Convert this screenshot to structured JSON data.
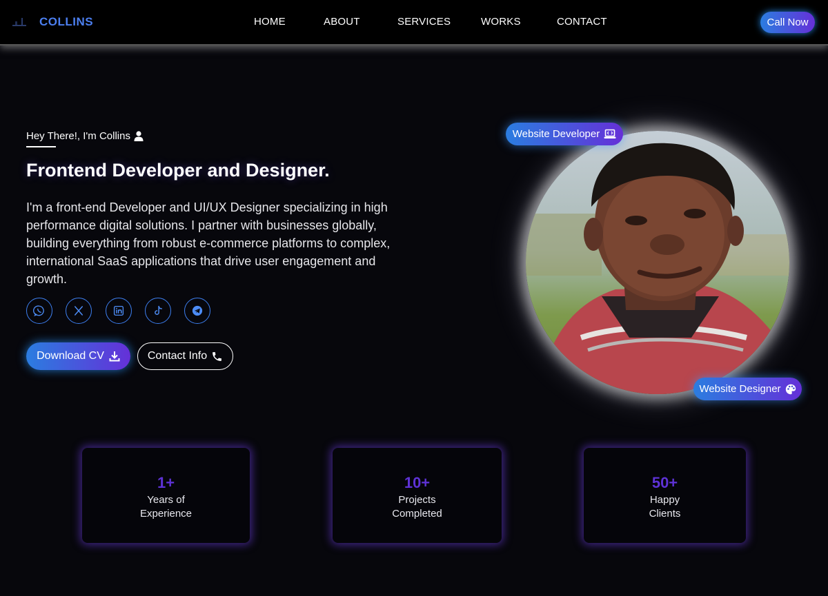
{
  "nav": {
    "brand": "COLLINS",
    "links": [
      {
        "label": "HOME"
      },
      {
        "label": "ABOUT"
      },
      {
        "label": "SERVICES"
      },
      {
        "label": "WORKS"
      },
      {
        "label": "CONTACT"
      }
    ],
    "call_button": "Call Now"
  },
  "hero": {
    "greeting": "Hey There!, I'm Collins",
    "headline": "Frontend Developer and Designer.",
    "bio": "I'm a front-end Developer and UI/UX Designer specializing in high performance digital solutions. I partner with businesses globally, building everything from robust e-commerce platforms to complex, international SaaS applications that drive user engagement and growth.",
    "socials": [
      {
        "icon": "whatsapp-icon"
      },
      {
        "icon": "x-icon"
      },
      {
        "icon": "linkedin-icon"
      },
      {
        "icon": "tiktok-icon"
      },
      {
        "icon": "telegram-icon"
      }
    ],
    "download_cv": "Download CV",
    "contact_info": "Contact Info",
    "tags": {
      "developer": "Website Developer",
      "designer": "Website Designer"
    }
  },
  "stats": [
    {
      "number": "1+",
      "label_line1": "Years of",
      "label_line2": "Experience"
    },
    {
      "number": "10+",
      "label_line1": "Projects",
      "label_line2": "Completed"
    },
    {
      "number": "50+",
      "label_line1": "Happy",
      "label_line2": "Clients"
    }
  ],
  "colors": {
    "accent_blue": "#2b7de0",
    "accent_purple": "#6530d8",
    "stat_number": "#5e32d6",
    "background": "#07070c"
  }
}
